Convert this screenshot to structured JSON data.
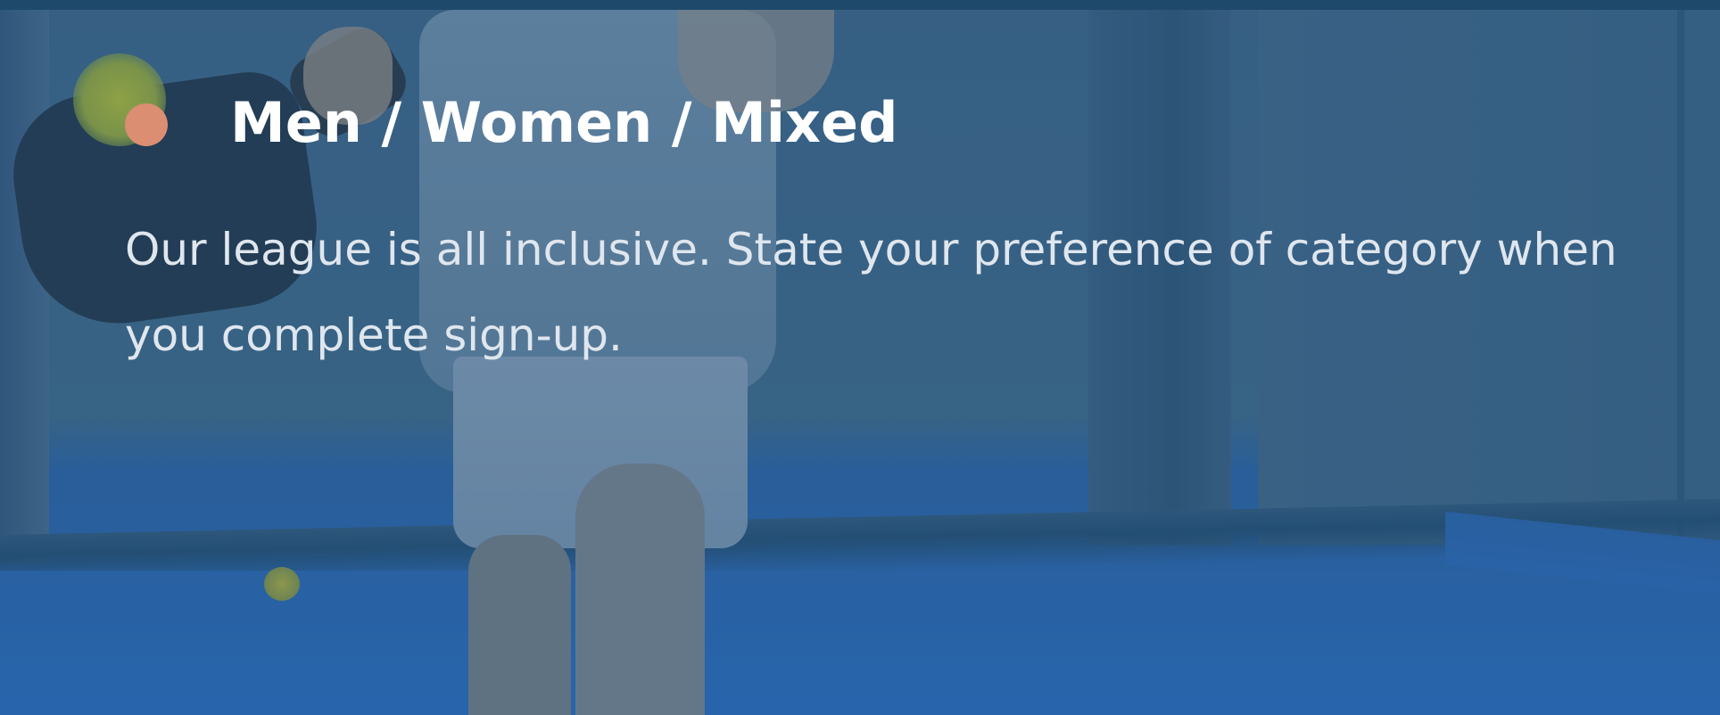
{
  "feature": {
    "heading": "Men / Women / Mixed",
    "description": "Our league is all inclusive. State your preference of category when you complete sign-up."
  },
  "colors": {
    "accent_dot": "#db8e71",
    "heading_text": "#ffffff",
    "body_text": "#dfe6ee",
    "overlay_blue": "#2a5679"
  },
  "background": {
    "icon_semantic": "pickleball-player-photo"
  }
}
